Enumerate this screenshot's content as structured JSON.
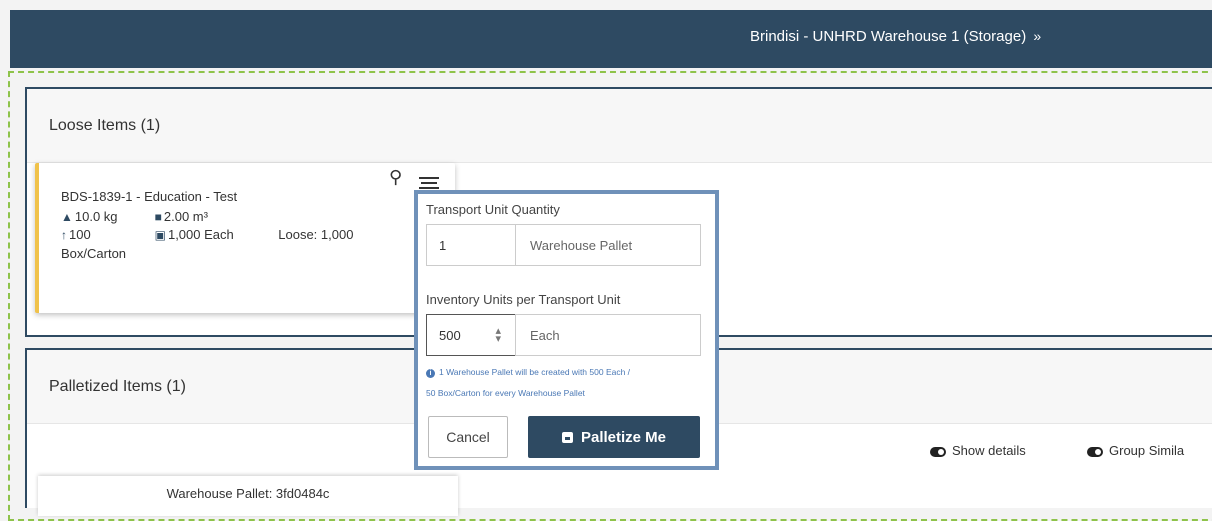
{
  "header": {
    "site_name": "Brindisi - UNHRD Warehouse 1 (Storage)",
    "chevron": "»"
  },
  "loose": {
    "title": "Loose Items (1)",
    "item": {
      "name": "BDS-1839-1 - Education - Test",
      "weight": "10.0 kg",
      "volume": "2.00 m³",
      "qty_up": "100",
      "each": "1,000 Each",
      "loose": "Loose: 1,000",
      "unit": "Box/Carton"
    }
  },
  "palletized": {
    "title": "Palletized Items (1)",
    "show_details": "Show details",
    "group_similar": "Group Simila",
    "pallet_label": "Warehouse Pallet: 3fd0484c"
  },
  "popover": {
    "tu_qty_label": "Transport Unit Quantity",
    "tu_qty_value": "1",
    "tu_type": "Warehouse Pallet",
    "inv_units_label": "Inventory Units per Transport Unit",
    "inv_units_value": "500",
    "inv_unit": "Each",
    "info_line1": "1 Warehouse Pallet will be created with 500 Each /",
    "info_line2": "50 Box/Carton for every Warehouse Pallet",
    "cancel": "Cancel",
    "submit": "Palletize Me"
  },
  "colors": {
    "header": "#2e4a62",
    "accent": "#f0c24a",
    "popover_border": "#6f91b9",
    "dash": "#8ec34a"
  }
}
